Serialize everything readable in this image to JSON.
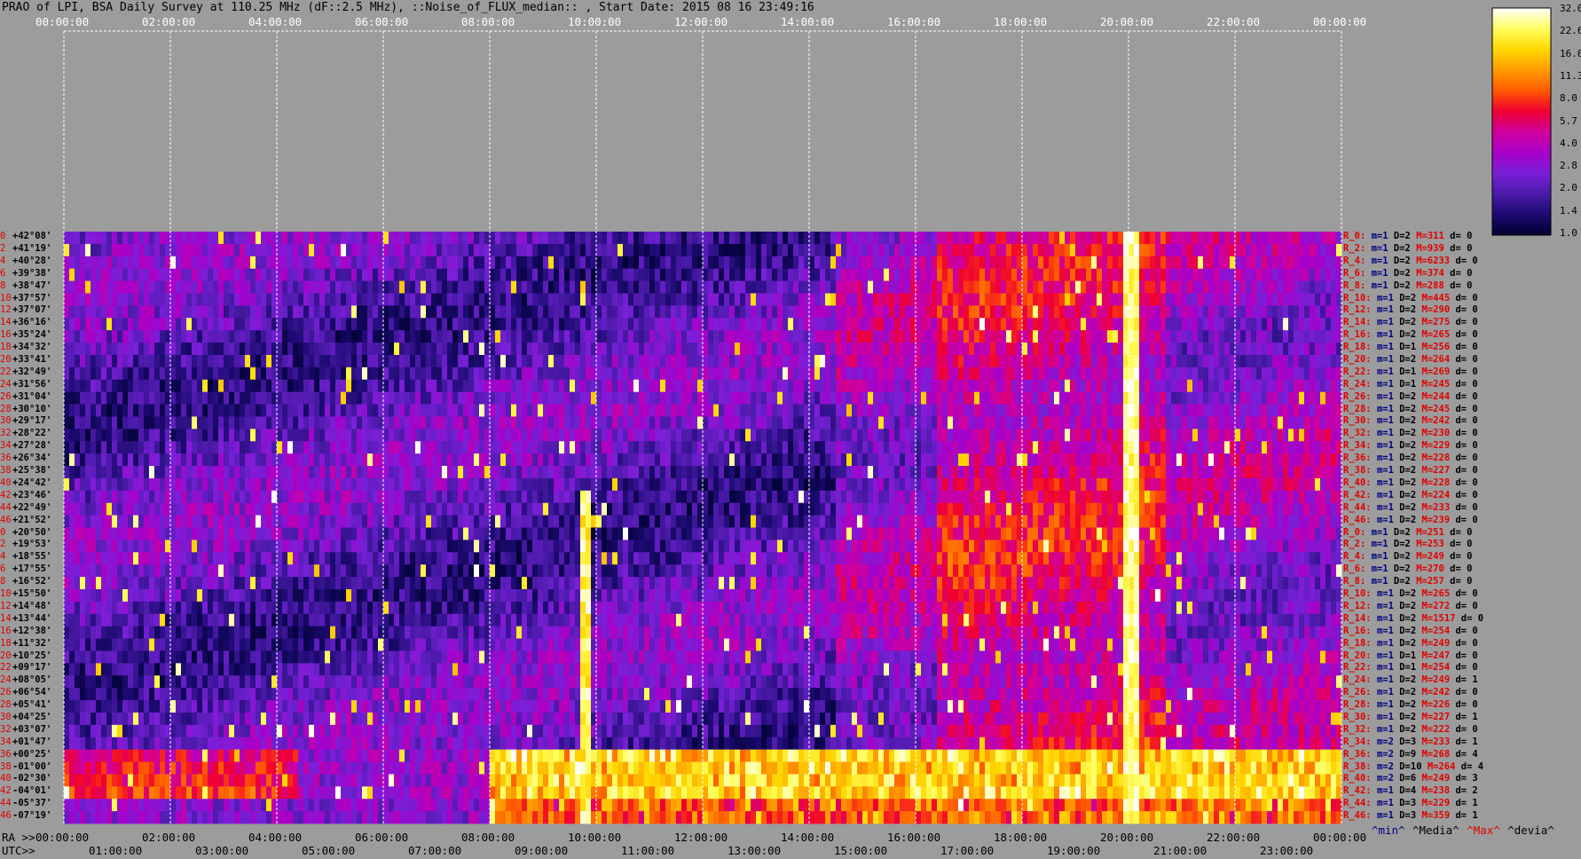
{
  "title": "PRAO of LPI, BSA Daily Survey at 110.25 MHz (dF::2.5 MHz), ::Noise_of_FLUX_median:: , Start Date: 2015 08 16 23:49:16",
  "chart_data": {
    "type": "heatmap",
    "top_ticks": [
      "00:00:00",
      "02:00:00",
      "04:00:00",
      "06:00:00",
      "08:00:00",
      "10:00:00",
      "12:00:00",
      "14:00:00",
      "16:00:00",
      "18:00:00",
      "20:00:00",
      "22:00:00",
      "00:00:00"
    ],
    "ra_ticks": [
      "00:00:00",
      "02:00:00",
      "04:00:00",
      "06:00:00",
      "08:00:00",
      "10:00:00",
      "12:00:00",
      "14:00:00",
      "16:00:00",
      "18:00:00",
      "20:00:00",
      "22:00:00",
      "00:00:00"
    ],
    "utc_ticks": [
      "01:00:00",
      "03:00:00",
      "05:00:00",
      "07:00:00",
      "09:00:00",
      "11:00:00",
      "13:00:00",
      "15:00:00",
      "17:00:00",
      "19:00:00",
      "21:00:00",
      "23:00:00"
    ],
    "ra_label": "RA >>",
    "utc_label": "UTC>>",
    "rows": [
      {
        "i": "0",
        "dec": "+42°08'"
      },
      {
        "i": "2",
        "dec": "+41°19'"
      },
      {
        "i": "4",
        "dec": "+40°28'"
      },
      {
        "i": "6",
        "dec": "+39°38'"
      },
      {
        "i": "8",
        "dec": "+38°47'"
      },
      {
        "i": "10",
        "dec": "+37°57'"
      },
      {
        "i": "12",
        "dec": "+37°07'"
      },
      {
        "i": "14",
        "dec": "+36°16'"
      },
      {
        "i": "16",
        "dec": "+35°24'"
      },
      {
        "i": "18",
        "dec": "+34°32'"
      },
      {
        "i": "20",
        "dec": "+33°41'"
      },
      {
        "i": "22",
        "dec": "+32°49'"
      },
      {
        "i": "24",
        "dec": "+31°56'"
      },
      {
        "i": "26",
        "dec": "+31°04'"
      },
      {
        "i": "28",
        "dec": "+30°10'"
      },
      {
        "i": "30",
        "dec": "+29°17'"
      },
      {
        "i": "32",
        "dec": "+28°22'"
      },
      {
        "i": "34",
        "dec": "+27°28'"
      },
      {
        "i": "36",
        "dec": "+26°34'"
      },
      {
        "i": "38",
        "dec": "+25°38'"
      },
      {
        "i": "40",
        "dec": "+24°42'"
      },
      {
        "i": "42",
        "dec": "+23°46'"
      },
      {
        "i": "44",
        "dec": "+22°49'"
      },
      {
        "i": "46",
        "dec": "+21°52'"
      },
      {
        "i": "0",
        "dec": "+20°50'"
      },
      {
        "i": "2",
        "dec": "+19°53'"
      },
      {
        "i": "4",
        "dec": "+18°55'"
      },
      {
        "i": "6",
        "dec": "+17°55'"
      },
      {
        "i": "8",
        "dec": "+16°52'"
      },
      {
        "i": "10",
        "dec": "+15°50'"
      },
      {
        "i": "12",
        "dec": "+14°48'"
      },
      {
        "i": "14",
        "dec": "+13°44'"
      },
      {
        "i": "16",
        "dec": "+12°38'"
      },
      {
        "i": "18",
        "dec": "+11°32'"
      },
      {
        "i": "20",
        "dec": "+10°25'"
      },
      {
        "i": "22",
        "dec": "+09°17'"
      },
      {
        "i": "24",
        "dec": "+08°05'"
      },
      {
        "i": "26",
        "dec": "+06°54'"
      },
      {
        "i": "28",
        "dec": "+05°41'"
      },
      {
        "i": "30",
        "dec": "+04°25'"
      },
      {
        "i": "32",
        "dec": "+03°07'"
      },
      {
        "i": "34",
        "dec": "+01°47'"
      },
      {
        "i": "36",
        "dec": "+00°25'"
      },
      {
        "i": "38",
        "dec": "-01°00'"
      },
      {
        "i": "40",
        "dec": "-02°30'"
      },
      {
        "i": "42",
        "dec": "-04°01'"
      },
      {
        "i": "44",
        "dec": "-05°37'"
      },
      {
        "i": "46",
        "dec": "-07°19'"
      }
    ],
    "annotations": [
      {
        "r": "R_0:",
        "m": "m=1",
        "d": "D=2",
        "M": "M=311",
        "dd": "d= 0"
      },
      {
        "r": "R_2:",
        "m": "m=1",
        "d": "D=2",
        "M": "M=939",
        "dd": "d= 0"
      },
      {
        "r": "R_4:",
        "m": "m=1",
        "d": "D=2",
        "M": "M=6233",
        "dd": "d= 0"
      },
      {
        "r": "R_6:",
        "m": "m=1",
        "d": "D=2",
        "M": "M=374",
        "dd": "d= 0"
      },
      {
        "r": "R_8:",
        "m": "m=1",
        "d": "D=2",
        "M": "M=288",
        "dd": "d= 0"
      },
      {
        "r": "R_10:",
        "m": "m=1",
        "d": "D=2",
        "M": "M=445",
        "dd": "d= 0"
      },
      {
        "r": "R_12:",
        "m": "m=1",
        "d": "D=2",
        "M": "M=290",
        "dd": "d= 0"
      },
      {
        "r": "R_14:",
        "m": "m=1",
        "d": "D=2",
        "M": "M=275",
        "dd": "d= 0"
      },
      {
        "r": "R_16:",
        "m": "m=1",
        "d": "D=2",
        "M": "M=265",
        "dd": "d= 0"
      },
      {
        "r": "R_18:",
        "m": "m=1",
        "d": "D=1",
        "M": "M=256",
        "dd": "d= 0"
      },
      {
        "r": "R_20:",
        "m": "m=1",
        "d": "D=2",
        "M": "M=264",
        "dd": "d= 0"
      },
      {
        "r": "R_22:",
        "m": "m=1",
        "d": "D=1",
        "M": "M=269",
        "dd": "d= 0"
      },
      {
        "r": "R_24:",
        "m": "m=1",
        "d": "D=1",
        "M": "M=245",
        "dd": "d= 0"
      },
      {
        "r": "R_26:",
        "m": "m=1",
        "d": "D=2",
        "M": "M=244",
        "dd": "d= 0"
      },
      {
        "r": "R_28:",
        "m": "m=1",
        "d": "D=2",
        "M": "M=245",
        "dd": "d= 0"
      },
      {
        "r": "R_30:",
        "m": "m=1",
        "d": "D=2",
        "M": "M=242",
        "dd": "d= 0"
      },
      {
        "r": "R_32:",
        "m": "m=1",
        "d": "D=2",
        "M": "M=230",
        "dd": "d= 0"
      },
      {
        "r": "R_34:",
        "m": "m=1",
        "d": "D=2",
        "M": "M=229",
        "dd": "d= 0"
      },
      {
        "r": "R_36:",
        "m": "m=1",
        "d": "D=2",
        "M": "M=228",
        "dd": "d= 0"
      },
      {
        "r": "R_38:",
        "m": "m=1",
        "d": "D=2",
        "M": "M=227",
        "dd": "d= 0"
      },
      {
        "r": "R_40:",
        "m": "m=1",
        "d": "D=2",
        "M": "M=228",
        "dd": "d= 0"
      },
      {
        "r": "R_42:",
        "m": "m=1",
        "d": "D=2",
        "M": "M=224",
        "dd": "d= 0"
      },
      {
        "r": "R_44:",
        "m": "m=1",
        "d": "D=2",
        "M": "M=233",
        "dd": "d= 0"
      },
      {
        "r": "R_46:",
        "m": "m=1",
        "d": "D=2",
        "M": "M=239",
        "dd": "d= 0"
      },
      {
        "r": "R_0:",
        "m": "m=1",
        "d": "D=2",
        "M": "M=251",
        "dd": "d= 0"
      },
      {
        "r": "R_2:",
        "m": "m=1",
        "d": "D=2",
        "M": "M=253",
        "dd": "d= 0"
      },
      {
        "r": "R_4:",
        "m": "m=1",
        "d": "D=2",
        "M": "M=249",
        "dd": "d= 0"
      },
      {
        "r": "R_6:",
        "m": "m=1",
        "d": "D=2",
        "M": "M=270",
        "dd": "d= 0"
      },
      {
        "r": "R_8:",
        "m": "m=1",
        "d": "D=2",
        "M": "M=257",
        "dd": "d= 0"
      },
      {
        "r": "R_10:",
        "m": "m=1",
        "d": "D=2",
        "M": "M=265",
        "dd": "d= 0"
      },
      {
        "r": "R_12:",
        "m": "m=1",
        "d": "D=2",
        "M": "M=272",
        "dd": "d= 0"
      },
      {
        "r": "R_14:",
        "m": "m=1",
        "d": "D=2",
        "M": "M=1517",
        "dd": "d= 0"
      },
      {
        "r": "R_16:",
        "m": "m=1",
        "d": "D=2",
        "M": "M=254",
        "dd": "d= 0"
      },
      {
        "r": "R_18:",
        "m": "m=1",
        "d": "D=2",
        "M": "M=249",
        "dd": "d= 0"
      },
      {
        "r": "R_20:",
        "m": "m=1",
        "d": "D=1",
        "M": "M=247",
        "dd": "d= 0"
      },
      {
        "r": "R_22:",
        "m": "m=1",
        "d": "D=1",
        "M": "M=254",
        "dd": "d= 0"
      },
      {
        "r": "R_24:",
        "m": "m=1",
        "d": "D=2",
        "M": "M=249",
        "dd": "d= 1"
      },
      {
        "r": "R_26:",
        "m": "m=1",
        "d": "D=2",
        "M": "M=242",
        "dd": "d= 0"
      },
      {
        "r": "R_28:",
        "m": "m=1",
        "d": "D=2",
        "M": "M=226",
        "dd": "d= 0"
      },
      {
        "r": "R_30:",
        "m": "m=1",
        "d": "D=2",
        "M": "M=227",
        "dd": "d= 1"
      },
      {
        "r": "R_32:",
        "m": "m=1",
        "d": "D=2",
        "M": "M=222",
        "dd": "d= 0"
      },
      {
        "r": "R_34:",
        "m": "m=2",
        "d": "D=3",
        "M": "M=233",
        "dd": "d= 1"
      },
      {
        "r": "R_36:",
        "m": "m=2",
        "d": "D=9",
        "M": "M=268",
        "dd": "d= 4"
      },
      {
        "r": "R_38:",
        "m": "m=2",
        "d": "D=10",
        "M": "M=264",
        "dd": "d= 4"
      },
      {
        "r": "R_40:",
        "m": "m=2",
        "d": "D=6",
        "M": "M=249",
        "dd": "d= 3"
      },
      {
        "r": "R_42:",
        "m": "m=1",
        "d": "D=4",
        "M": "M=238",
        "dd": "d= 2"
      },
      {
        "r": "R_44:",
        "m": "m=1",
        "d": "D=3",
        "M": "M=229",
        "dd": "d= 1"
      },
      {
        "r": "R_46:",
        "m": "m=1",
        "d": "D=3",
        "M": "M=359",
        "dd": "d= 1"
      }
    ],
    "colorbar": {
      "labels": [
        "32.0",
        "22.6",
        "16.0",
        "11.3",
        "8.0",
        "5.7",
        "4.0",
        "2.8",
        "2.0",
        "1.4",
        "1.0"
      ],
      "colors": [
        "#000030",
        "#1c0a70",
        "#4a1aa8",
        "#7a20d8",
        "#a800c8",
        "#d0009c",
        "#f00030",
        "#ff5a00",
        "#ff9a00",
        "#ffd800",
        "#ffff60",
        "#ffffff"
      ]
    },
    "legend": [
      {
        "text": "^min^",
        "color": "#000080"
      },
      {
        "text": "^Media^",
        "color": "#000000"
      },
      {
        "text": "^Max^",
        "color": "#e00000"
      },
      {
        "text": "^devia^",
        "color": "#000000"
      }
    ]
  }
}
